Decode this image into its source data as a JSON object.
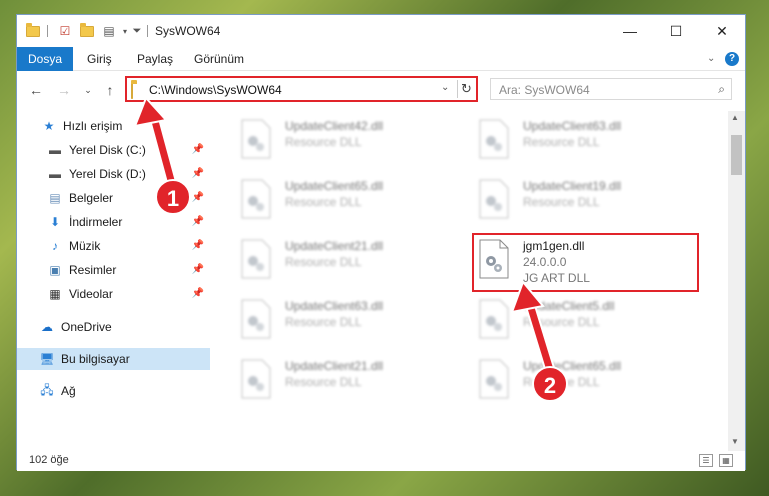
{
  "window": {
    "title": "SysWOW64",
    "controls": {
      "minimize": "—",
      "maximize": "☐",
      "close": "✕"
    }
  },
  "ribbon": {
    "tabs": [
      {
        "label": "Dosya",
        "active": true
      },
      {
        "label": "Giriş"
      },
      {
        "label": "Paylaş"
      },
      {
        "label": "Görünüm"
      }
    ],
    "help": "?"
  },
  "address": {
    "path": "C:\\Windows\\SysWOW64",
    "search_placeholder": "Ara: SysWOW64"
  },
  "sidebar": {
    "items": [
      {
        "label": "Hızlı erişim",
        "icon": "star-icon",
        "pinned": false
      },
      {
        "label": "Yerel Disk (C:)",
        "icon": "drive-icon",
        "pinned": true
      },
      {
        "label": "Yerel Disk (D:)",
        "icon": "drive-icon",
        "pinned": true
      },
      {
        "label": "Belgeler",
        "icon": "documents-icon",
        "pinned": true
      },
      {
        "label": "İndirmeler",
        "icon": "download-icon",
        "pinned": true
      },
      {
        "label": "Müzik",
        "icon": "music-icon",
        "pinned": true
      },
      {
        "label": "Resimler",
        "icon": "pictures-icon",
        "pinned": true
      },
      {
        "label": "Videolar",
        "icon": "videos-icon",
        "pinned": true
      },
      {
        "label": "OneDrive",
        "icon": "cloud-icon",
        "pinned": false
      },
      {
        "label": "Bu bilgisayar",
        "icon": "computer-icon",
        "pinned": false,
        "selected": true
      },
      {
        "label": "Ağ",
        "icon": "network-icon",
        "pinned": false
      }
    ]
  },
  "files": [
    {
      "name": "UpdateClient42.dll",
      "desc": "Resource DLL",
      "blurred": true
    },
    {
      "name": "UpdateClient63.dll",
      "desc": "Resource DLL",
      "blurred": true
    },
    {
      "name": "UpdateClient65.dll",
      "desc": "Resource DLL",
      "blurred": true
    },
    {
      "name": "UpdateClient19.dll",
      "desc": "Resource DLL",
      "blurred": true
    },
    {
      "name": "UpdateClient21.dll",
      "desc": "Resource DLL",
      "blurred": true
    },
    {
      "name": "jgm1gen.dll",
      "version": "24.0.0.0",
      "desc": "JG ART DLL",
      "blurred": false
    },
    {
      "name": "UpdateClient63.dll",
      "desc": "Resource DLL",
      "blurred": true
    },
    {
      "name": "UpdateClient5.dll",
      "desc": "Resource DLL",
      "blurred": true
    },
    {
      "name": "UpdateClient21.dll",
      "desc": "Resource DLL",
      "blurred": true
    },
    {
      "name": "UpdateClient65.dll",
      "desc": "Resource DLL",
      "blurred": true
    }
  ],
  "status": {
    "item_count": "102 öğe"
  },
  "annotations": {
    "callout_1": "1",
    "callout_2": "2"
  },
  "colors": {
    "accent": "#1979ca",
    "annotation": "#e1242a",
    "selection": "#cce4f7"
  }
}
